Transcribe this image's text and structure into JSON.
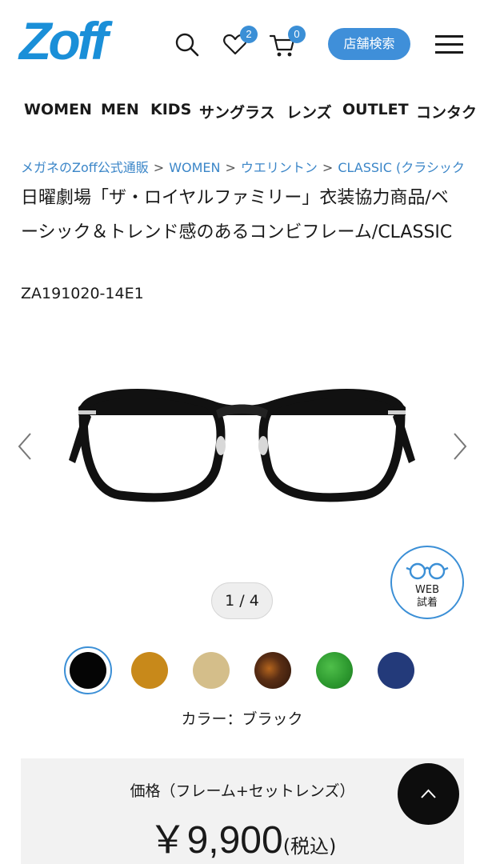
{
  "header": {
    "logo": "Zoff",
    "favorites_count": "2",
    "cart_count": "0",
    "store_search_label": "店舗検索"
  },
  "nav": {
    "items": [
      "WOMEN",
      "MEN",
      "KIDS",
      "サングラス",
      "レンズ",
      "OUTLET",
      "コンタク"
    ]
  },
  "breadcrumb": {
    "items": [
      "メガネのZoff公式通販",
      "WOMEN",
      "ウエリントン",
      "CLASSIC (クラシック"
    ],
    "separator": ">"
  },
  "product": {
    "title": "日曜劇場「ザ・ロイヤルファミリー」衣装協力商品/ベーシック＆トレンド感のあるコンビフレーム/CLASSIC",
    "code": "ZA191020-14E1"
  },
  "gallery": {
    "counter": "1 / 4",
    "web_try_line1": "WEB",
    "web_try_line2": "試着"
  },
  "colors": {
    "swatches": [
      "#050505",
      "#c8891a",
      "#d4be8a",
      "#4a2a18",
      "#2e9a30",
      "#233a7a"
    ],
    "selected_index": 0,
    "label": "カラー：ブラック"
  },
  "price": {
    "label": "価格（フレーム+セットレンズ）",
    "amount": "￥9,900",
    "tax_note": "(税込)"
  }
}
